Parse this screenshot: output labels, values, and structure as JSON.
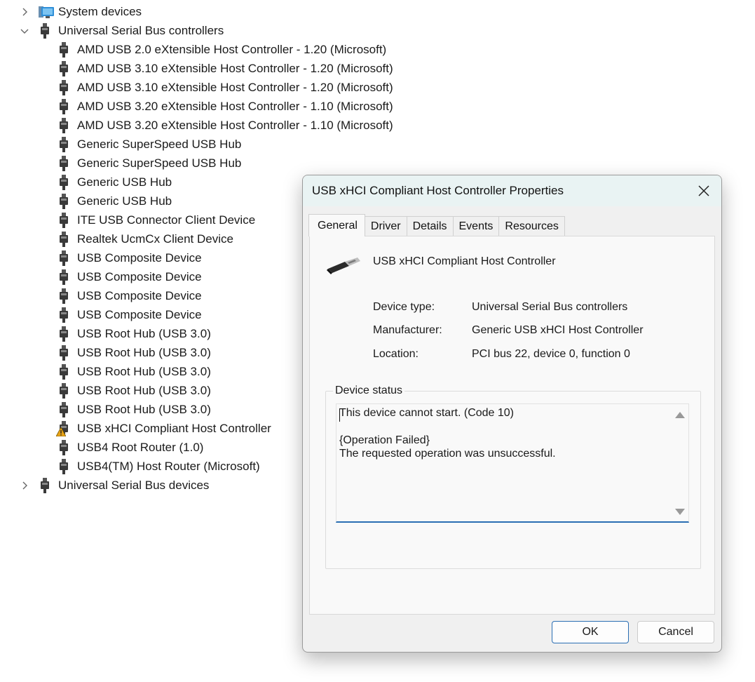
{
  "tree": {
    "top_items": [
      {
        "label": "System devices",
        "expanded": false,
        "icon": "system-devices-icon"
      },
      {
        "label": "Universal Serial Bus controllers",
        "expanded": true,
        "icon": "usb-plug-icon"
      }
    ],
    "children": [
      {
        "label": "AMD USB 2.0 eXtensible Host Controller - 1.20 (Microsoft)"
      },
      {
        "label": "AMD USB 3.10 eXtensible Host Controller - 1.20 (Microsoft)"
      },
      {
        "label": "AMD USB 3.10 eXtensible Host Controller - 1.20 (Microsoft)"
      },
      {
        "label": "AMD USB 3.20 eXtensible Host Controller - 1.10 (Microsoft)"
      },
      {
        "label": "AMD USB 3.20 eXtensible Host Controller - 1.10 (Microsoft)"
      },
      {
        "label": "Generic SuperSpeed USB Hub"
      },
      {
        "label": "Generic SuperSpeed USB Hub"
      },
      {
        "label": "Generic USB Hub"
      },
      {
        "label": "Generic USB Hub"
      },
      {
        "label": "ITE USB Connector Client Device"
      },
      {
        "label": "Realtek UcmCx Client Device"
      },
      {
        "label": "USB Composite Device"
      },
      {
        "label": "USB Composite Device"
      },
      {
        "label": "USB Composite Device"
      },
      {
        "label": "USB Composite Device"
      },
      {
        "label": "USB Root Hub (USB 3.0)"
      },
      {
        "label": "USB Root Hub (USB 3.0)"
      },
      {
        "label": "USB Root Hub (USB 3.0)"
      },
      {
        "label": "USB Root Hub (USB 3.0)"
      },
      {
        "label": "USB Root Hub (USB 3.0)"
      },
      {
        "label": "USB xHCI Compliant Host Controller",
        "warning": true
      },
      {
        "label": "USB4 Root Router (1.0)"
      },
      {
        "label": "USB4(TM) Host Router (Microsoft)"
      }
    ],
    "bottom_item": {
      "label": "Universal Serial Bus devices",
      "expanded": false
    }
  },
  "dialog": {
    "title": "USB xHCI Compliant Host Controller Properties",
    "tabs": [
      "General",
      "Driver",
      "Details",
      "Events",
      "Resources"
    ],
    "active_tab": "General",
    "device_name": "USB xHCI Compliant Host Controller",
    "properties": [
      {
        "key": "Device type:",
        "value": "Universal Serial Bus controllers"
      },
      {
        "key": "Manufacturer:",
        "value": "Generic USB xHCI Host Controller"
      },
      {
        "key": "Location:",
        "value": "PCI bus 22, device 0, function 0"
      }
    ],
    "status_group_label": "Device status",
    "status_lines": [
      "This device cannot start. (Code 10)",
      "",
      "{Operation Failed}",
      "The requested operation was unsuccessful."
    ],
    "ok_label": "OK",
    "cancel_label": "Cancel"
  },
  "colors": {
    "accent": "#2a6eb3",
    "warning": "#e8a317",
    "titlebar": "#e9f3f3"
  }
}
